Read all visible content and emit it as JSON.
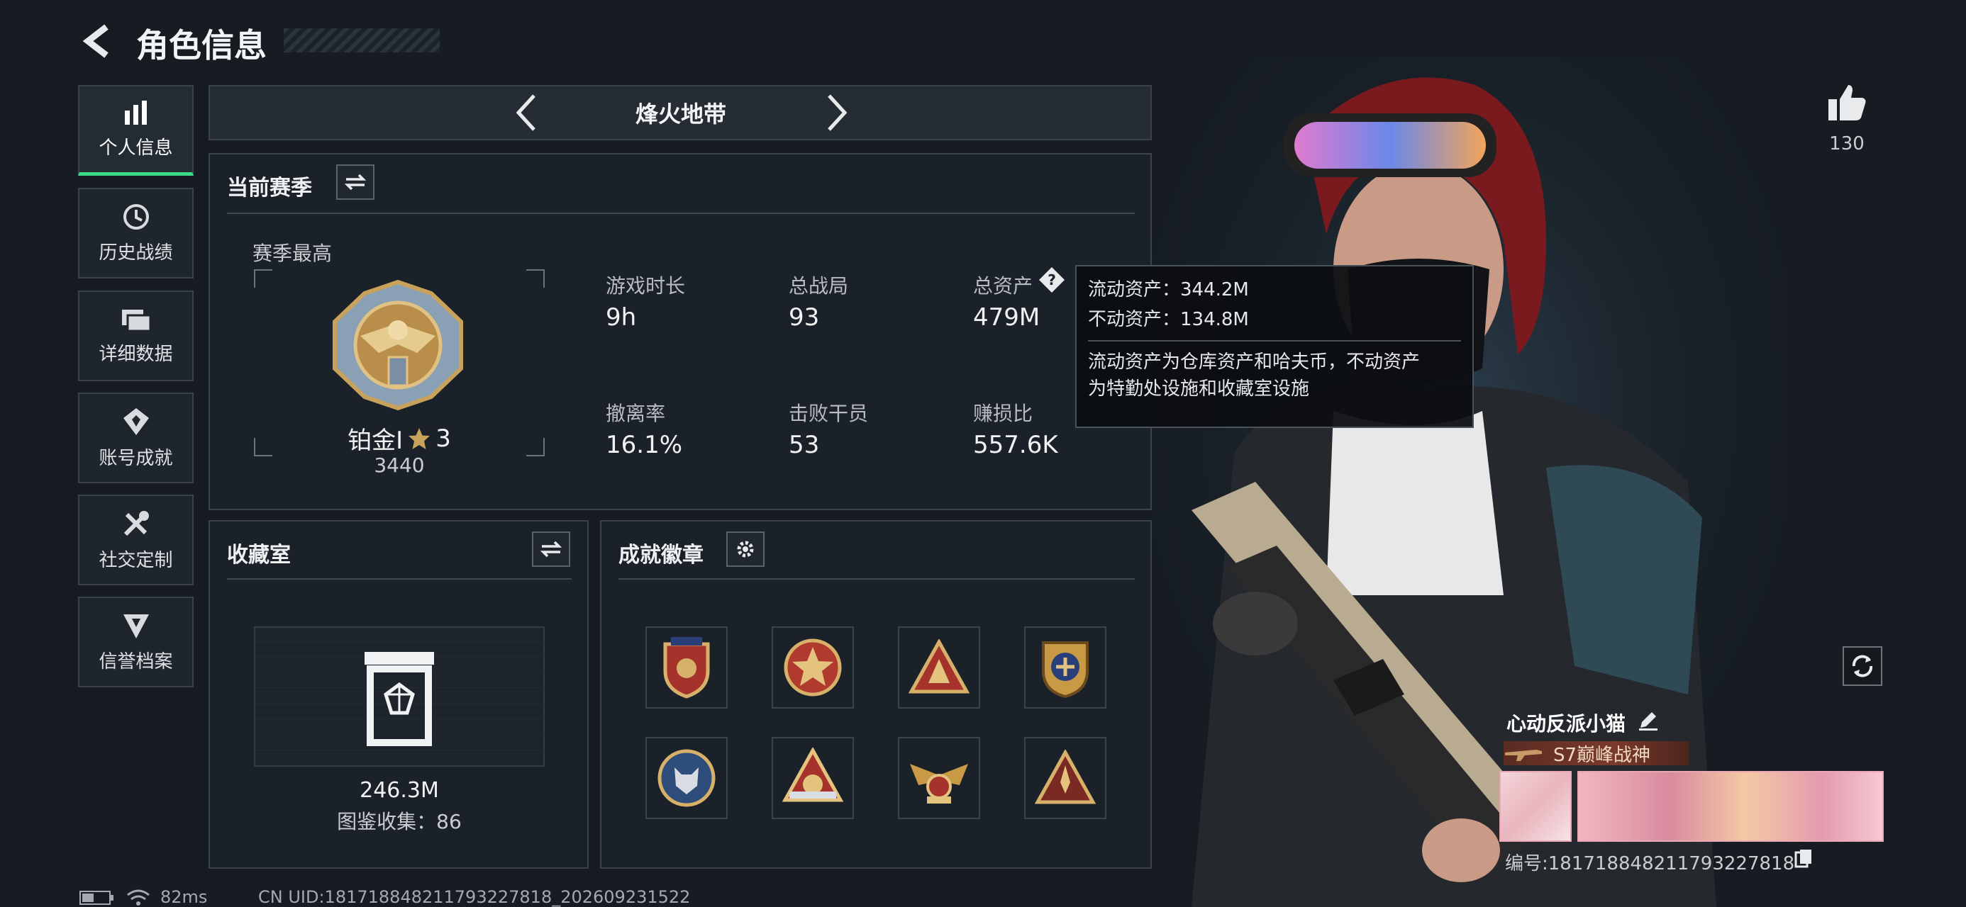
{
  "header": {
    "title": "角色信息"
  },
  "sidebar": {
    "items": [
      {
        "label": "个人信息",
        "icon": "bar-chart-icon",
        "active": true
      },
      {
        "label": "历史战绩",
        "icon": "clock-icon"
      },
      {
        "label": "详细数据",
        "icon": "folder-icon"
      },
      {
        "label": "账号成就",
        "icon": "medal-icon"
      },
      {
        "label": "社交定制",
        "icon": "tools-icon"
      },
      {
        "label": "信誉档案",
        "icon": "shield-icon"
      }
    ]
  },
  "mode_selector": {
    "label": "烽火地带"
  },
  "season": {
    "title": "当前赛季",
    "best_label": "赛季最高",
    "rank_name": "铂金Ⅰ",
    "rank_stars": "3",
    "rank_points": "3440",
    "stats": [
      {
        "label": "游戏时长",
        "value": "9h"
      },
      {
        "label": "总战局",
        "value": "93"
      },
      {
        "label": "总资产",
        "value": "479M"
      },
      {
        "label": "撤离率",
        "value": "16.1%"
      },
      {
        "label": "击败干员",
        "value": "53"
      },
      {
        "label": "赚损比",
        "value": "557.6K"
      }
    ]
  },
  "tooltip": {
    "liquid": "流动资产：344.2M",
    "fixed": "不动资产：134.8M",
    "desc_line1": "流动资产为仓库资产和哈夫币，不动资产",
    "desc_line2": "为特勤处设施和收藏室设施"
  },
  "collection": {
    "title": "收藏室",
    "value": "246.3M",
    "catalog": "图鉴收集：86"
  },
  "achievements": {
    "title": "成就徽章",
    "badge_count": 8
  },
  "likes": {
    "count": "130"
  },
  "player": {
    "name": "心动反派小猫",
    "title_badge": "S7巅峰战神",
    "id_text": "编号:1817188482117932278​18"
  },
  "status_bar": {
    "ping": "82ms",
    "uid": "CN UID:1817188482117932278​18_202609231522"
  },
  "colors": {
    "accent_green": "#39d98a",
    "gold": "#c8a25a",
    "background": "#161c22"
  }
}
